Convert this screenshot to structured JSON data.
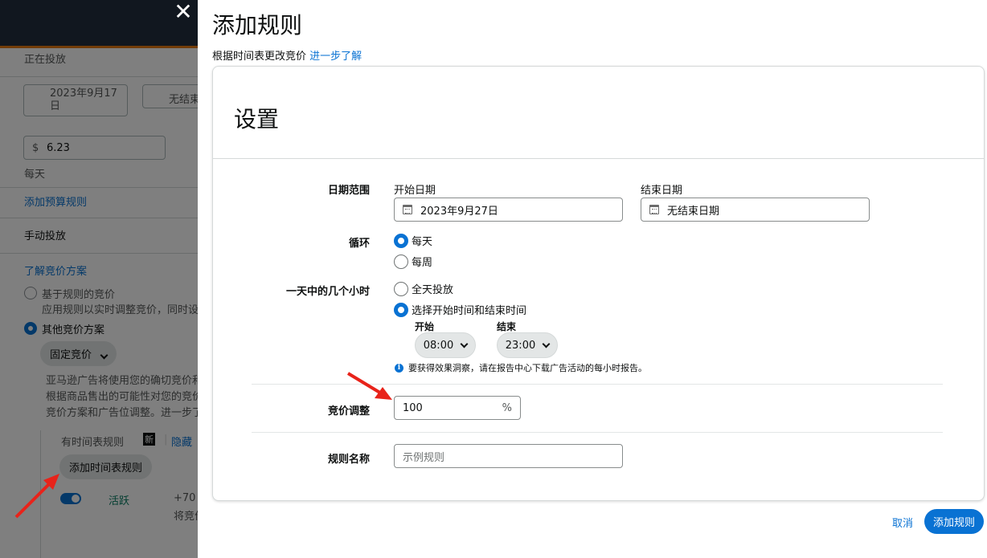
{
  "background": {
    "status": "正在投放",
    "start_date": "2023年9月17日",
    "end_date": "无结束",
    "budget_currency": "$",
    "budget_value": "6.23",
    "budget_period": "每天",
    "add_budget_rule": "添加预算规则",
    "targeting": "手动投放",
    "learn_bidding": "了解竞价方案",
    "rule_based_title": "基于规则的竞价",
    "rule_based_desc": "应用规则以实时调整竞价，同时设",
    "other_bidding": "其他竞价方案",
    "fixed_bid": "固定竞价",
    "desc_line1": "亚马逊广告将使用您的确切竞价和",
    "desc_line2": "根据商品售出的可能性对您的竞价",
    "desc_line3": "竞价方案和广告位调整。进一步了",
    "schedule_rule": "有时间表规则",
    "new_badge": "新",
    "hide": "隐藏",
    "add_schedule_rule": "添加时间表规则",
    "active": "活跃",
    "plus_value": "+70",
    "bid_trunc": "将竞价"
  },
  "panel": {
    "title": "添加规则",
    "subtitle": "根据时间表更改竞价",
    "learn_more": "进一步了解",
    "settings_title": "设置",
    "date_range": {
      "label": "日期范围",
      "start_label": "开始日期",
      "start_value": "2023年9月27日",
      "end_label": "结束日期",
      "end_value": "无结束日期"
    },
    "recurrence": {
      "label": "循环",
      "daily": "每天",
      "weekly": "每周",
      "selected": "每天"
    },
    "hours": {
      "label": "一天中的几个小时",
      "all_day": "全天投放",
      "custom": "选择开始时间和结束时间",
      "selected": "选择开始时间和结束时间",
      "start_label": "开始",
      "start_value": "08:00",
      "end_label": "结束",
      "end_value": "23:00",
      "info": "要获得效果洞察，请在报告中心下载广告活动的每小时报告。"
    },
    "bid_adjust": {
      "label": "竞价调整",
      "value": "100",
      "unit": "%"
    },
    "rule_name": {
      "label": "规则名称",
      "placeholder": "示例规则"
    },
    "cancel": "取消",
    "submit": "添加规则"
  },
  "colors": {
    "accent": "#0972d3",
    "annotation_arrow": "#e8231a",
    "topbar": "#232f3e"
  },
  "icons": [
    "close-icon",
    "calendar-icon",
    "chevron-down-icon",
    "info-icon",
    "toggle-icon"
  ]
}
